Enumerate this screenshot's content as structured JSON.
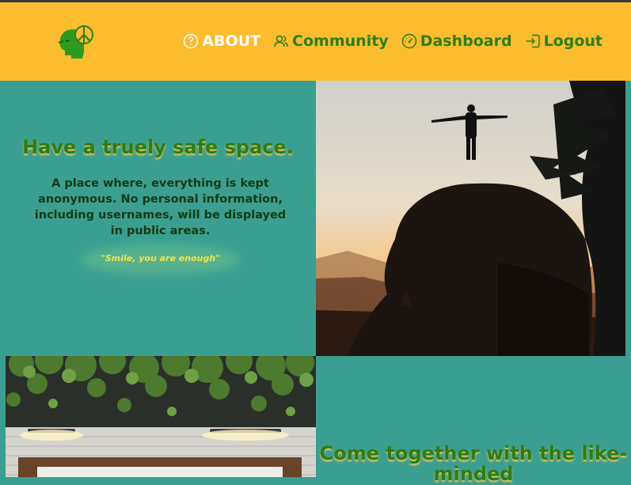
{
  "nav": {
    "items": [
      {
        "label": "ABOUT",
        "icon": "question-circle-icon"
      },
      {
        "label": "Community",
        "icon": "users-icon"
      },
      {
        "label": "Dashboard",
        "icon": "gauge-icon"
      },
      {
        "label": "Logout",
        "icon": "logout-icon"
      }
    ]
  },
  "hero": {
    "title": "Have a truely safe space.",
    "description": "A place where, everything is kept anonymous. No personal information, including usernames, will be displayed in public areas.",
    "quote": "\"Smile, you are enough\""
  },
  "section2": {
    "title": "Come together with the like-minded"
  },
  "colors": {
    "header_bg": "#fbbd2e",
    "nav_text": "#2e7d17",
    "nav_active": "#ffffff",
    "teal_bg": "#3a9f91",
    "heading_green": "#2e7d17"
  }
}
